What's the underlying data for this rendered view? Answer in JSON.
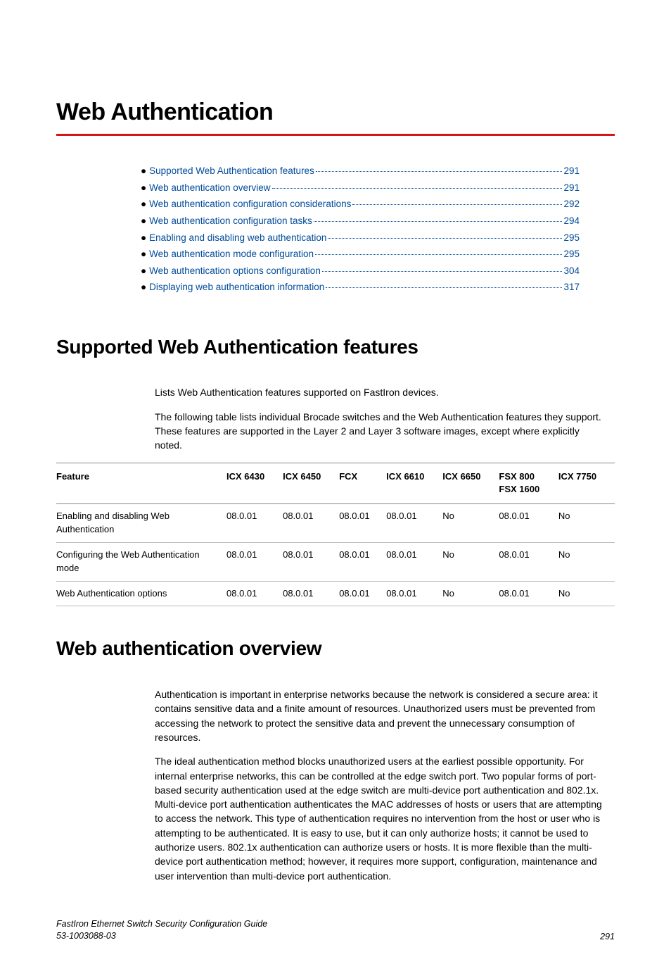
{
  "chapter": {
    "title": "Web Authentication"
  },
  "toc": [
    {
      "label": "Supported Web Authentication features",
      "page": "291"
    },
    {
      "label": "Web authentication overview",
      "page": "291"
    },
    {
      "label": "Web authentication configuration considerations",
      "page": "292"
    },
    {
      "label": "Web authentication configuration tasks",
      "page": "294"
    },
    {
      "label": "Enabling and disabling web authentication",
      "page": "295"
    },
    {
      "label": "Web authentication mode configuration",
      "page": "295"
    },
    {
      "label": "Web authentication options configuration",
      "page": "304"
    },
    {
      "label": "Displaying web authentication information",
      "page": "317"
    }
  ],
  "section1": {
    "heading": "Supported Web Authentication features",
    "p1": "Lists Web Authentication features supported on FastIron devices.",
    "p2": "The following table lists individual Brocade switches and the Web Authentication features they support. These features are supported in the Layer 2 and Layer 3 software images, except where explicitly noted."
  },
  "table": {
    "headers": {
      "c0": "Feature",
      "c1": "ICX 6430",
      "c2": "ICX 6450",
      "c3": "FCX",
      "c4": "ICX 6610",
      "c5": "ICX 6650",
      "c6a": "FSX 800",
      "c6b": "FSX 1600",
      "c7": "ICX 7750"
    },
    "rows": [
      {
        "c0": "Enabling and disabling Web Authentication",
        "c1": "08.0.01",
        "c2": "08.0.01",
        "c3": "08.0.01",
        "c4": "08.0.01",
        "c5": "No",
        "c6": "08.0.01",
        "c7": "No"
      },
      {
        "c0": "Configuring the Web Authentication mode",
        "c1": "08.0.01",
        "c2": "08.0.01",
        "c3": "08.0.01",
        "c4": "08.0.01",
        "c5": "No",
        "c6": "08.0.01",
        "c7": "No"
      },
      {
        "c0": "Web Authentication options",
        "c1": "08.0.01",
        "c2": "08.0.01",
        "c3": "08.0.01",
        "c4": "08.0.01",
        "c5": "No",
        "c6": "08.0.01",
        "c7": "No"
      }
    ]
  },
  "section2": {
    "heading": "Web authentication overview",
    "p1": "Authentication is important in enterprise networks because the network is considered a secure area: it contains sensitive data and a finite amount of resources. Unauthorized users must be prevented from accessing the network to protect the sensitive data and prevent the unnecessary consumption of resources.",
    "p2": "The ideal authentication method blocks unauthorized users at the earliest possible opportunity. For internal enterprise networks, this can be controlled at the edge switch port. Two popular forms of port-based security authentication used at the edge switch are multi-device port authentication and 802.1x. Multi-device port authentication authenticates the MAC addresses of hosts or users that are attempting to access the network. This type of authentication requires no intervention from the host or user who is attempting to be authenticated. It is easy to use, but it can only authorize hosts; it cannot be used to authorize users. 802.1x authentication can authorize users or hosts. It is more flexible than the multi-device port authentication method; however, it requires more support, configuration, maintenance and user intervention than multi-device port authentication."
  },
  "footer": {
    "book": "FastIron Ethernet Switch Security Configuration Guide",
    "docnum": "53-1003088-03",
    "page": "291"
  }
}
